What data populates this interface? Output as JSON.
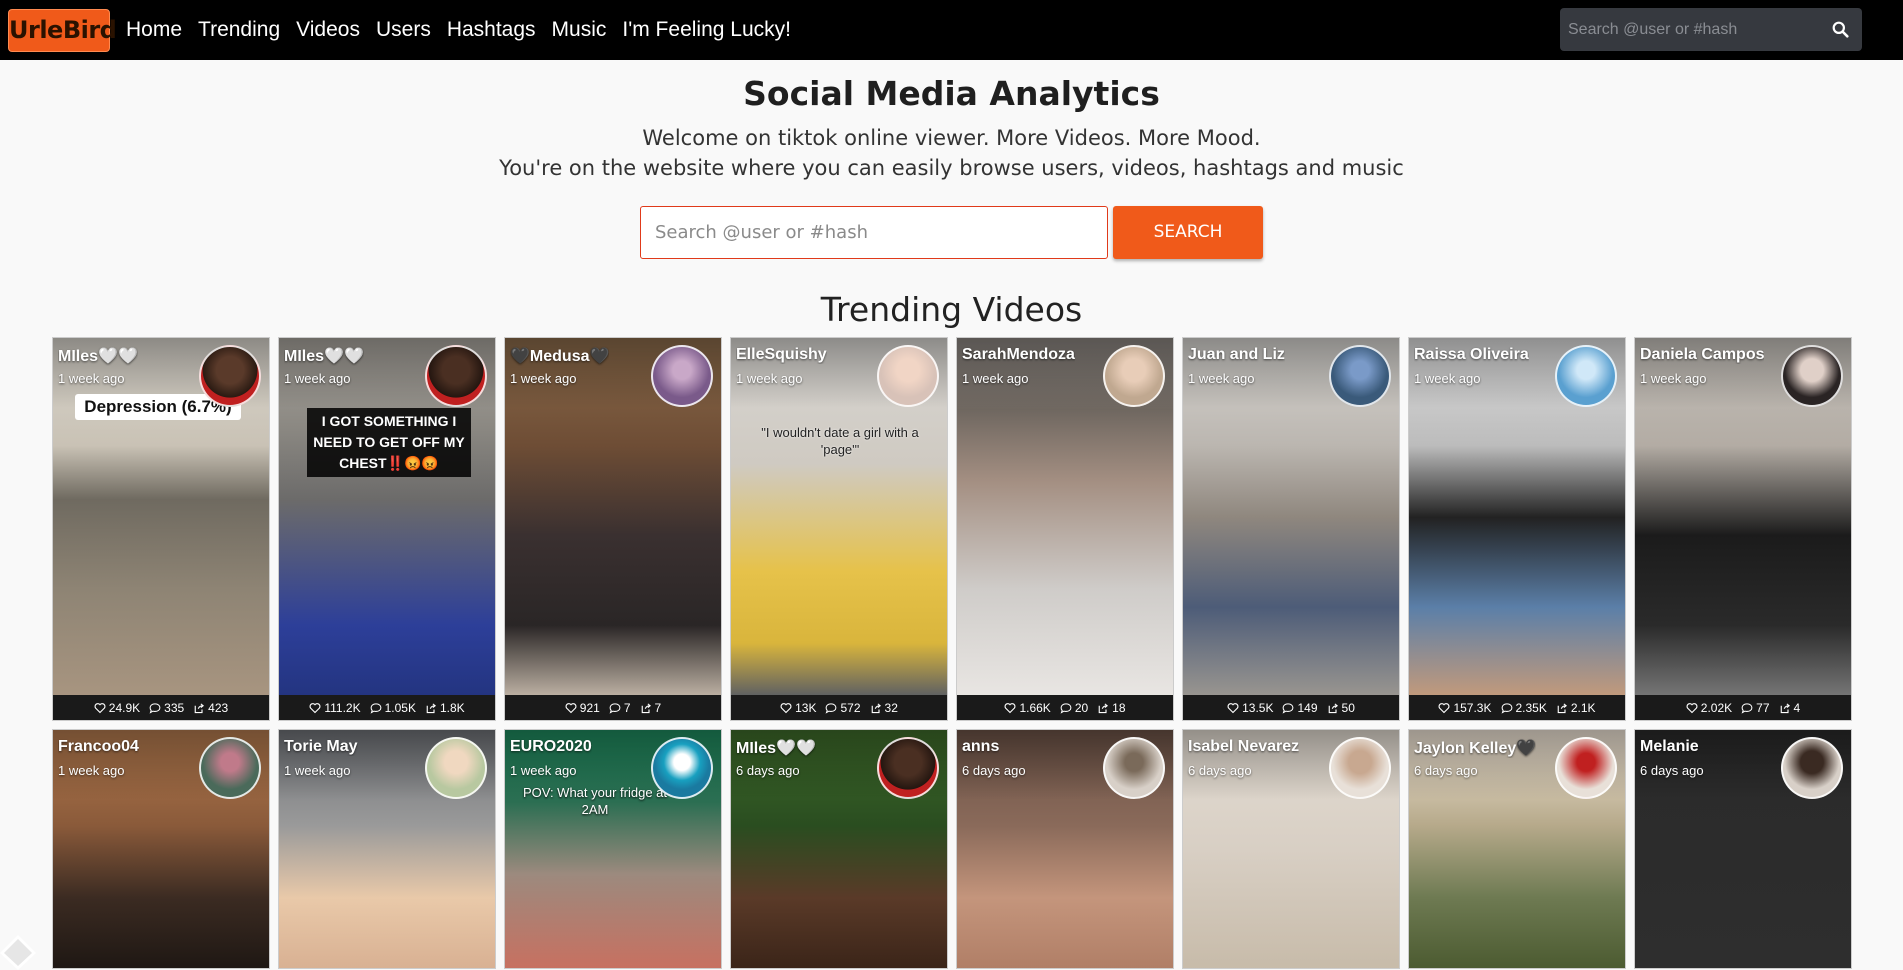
{
  "nav": {
    "logo": "UrleBird",
    "links": [
      "Home",
      "Trending",
      "Videos",
      "Users",
      "Hashtags",
      "Music",
      "I'm Feeling Lucky!"
    ],
    "search_placeholder": "Search @user or #hash"
  },
  "hero": {
    "title": "Social Media Analytics",
    "line1": "Welcome on tiktok online viewer. More Videos. More Mood.",
    "line2": "You're on the website where you can easily browse users, videos, hashtags and music",
    "search_placeholder": "Search @user or #hash",
    "search_button": "SEARCH"
  },
  "section_title": "Trending Videos",
  "colors": {
    "accent": "#f05a1a",
    "nav_bg": "#000000",
    "stats_bg": "#1a1a1a"
  },
  "videos": [
    {
      "author": "MIles🤍🤍",
      "time": "1 week ago",
      "likes": "24.9K",
      "comments": "335",
      "shares": "423",
      "overlay": "Depression (6.7%)"
    },
    {
      "author": "MIles🤍🤍",
      "time": "1 week ago",
      "likes": "111.2K",
      "comments": "1.05K",
      "shares": "1.8K",
      "overlay": "I GOT SOMETHING I NEED TO GET OFF MY CHEST‼️😡😡"
    },
    {
      "author": "🖤Medusa🖤",
      "time": "1 week ago",
      "likes": "921",
      "comments": "7",
      "shares": "7",
      "overlay": ""
    },
    {
      "author": "ElleSquishy",
      "time": "1 week ago",
      "likes": "13K",
      "comments": "572",
      "shares": "32",
      "overlay": "\"I wouldn't date a girl with a 'page'\""
    },
    {
      "author": "SarahMendoza",
      "time": "1 week ago",
      "likes": "1.66K",
      "comments": "20",
      "shares": "18",
      "overlay": ""
    },
    {
      "author": "Juan and Liz",
      "time": "1 week ago",
      "likes": "13.5K",
      "comments": "149",
      "shares": "50",
      "overlay": ""
    },
    {
      "author": "Raissa Oliveira",
      "time": "1 week ago",
      "likes": "157.3K",
      "comments": "2.35K",
      "shares": "2.1K",
      "overlay": ""
    },
    {
      "author": "Daniela Campos",
      "time": "1 week ago",
      "likes": "2.02K",
      "comments": "77",
      "shares": "4",
      "overlay": ""
    },
    {
      "author": "Francoo04",
      "time": "1 week ago",
      "overlay": ""
    },
    {
      "author": "Torie May",
      "time": "1 week ago",
      "overlay": ""
    },
    {
      "author": "EURO2020",
      "time": "1 week ago",
      "overlay": "POV: What your fridge at 2AM"
    },
    {
      "author": "MIles🤍🤍",
      "time": "6 days ago",
      "overlay": ""
    },
    {
      "author": "anns",
      "time": "6 days ago",
      "overlay": ""
    },
    {
      "author": "Isabel Nevarez",
      "time": "6 days ago",
      "overlay": ""
    },
    {
      "author": "Jaylon Kelley🖤",
      "time": "6 days ago",
      "overlay": ""
    },
    {
      "author": "Melanie",
      "time": "6 days ago",
      "overlay": ""
    }
  ]
}
